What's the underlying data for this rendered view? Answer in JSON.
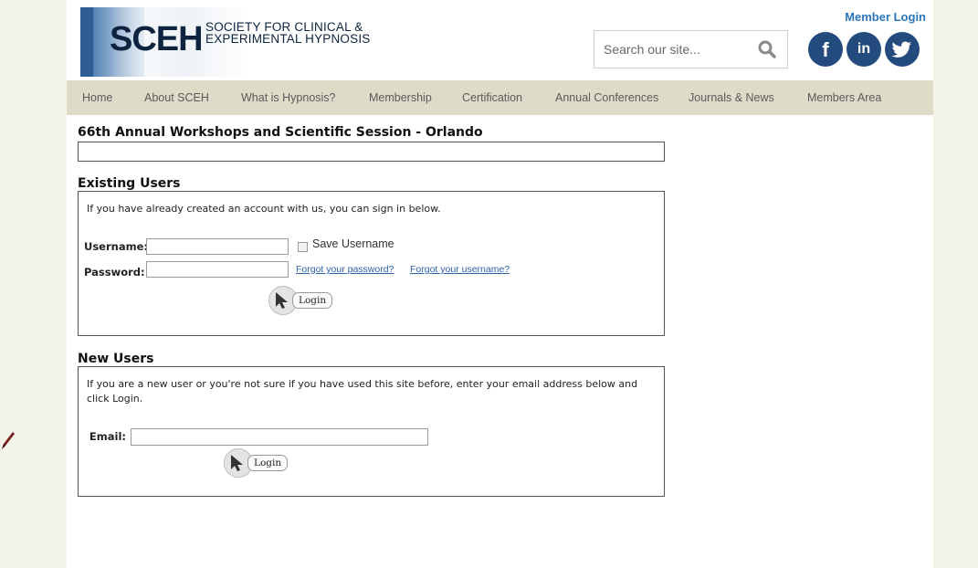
{
  "header": {
    "logo_text": "SCEH",
    "logo_sub_line1": "SOCIETY FOR CLINICAL &",
    "logo_sub_line2": "EXPERIMENTAL HYPNOSIS",
    "member_login": "Member Login",
    "search_placeholder": "Search our site...",
    "social": [
      {
        "name": "facebook",
        "glyph": "f"
      },
      {
        "name": "linkedin",
        "glyph": "in"
      },
      {
        "name": "twitter",
        "glyph": ""
      }
    ]
  },
  "nav": {
    "items": [
      "Home",
      "About SCEH",
      "What is Hypnosis?",
      "Membership",
      "Certification",
      "Annual Conferences",
      "Journals & News",
      "Members Area"
    ]
  },
  "page": {
    "title": "66th Annual Workshops and Scientific Session - Orlando"
  },
  "existing_users": {
    "heading": "Existing Users",
    "intro": "If you have already created an account with us, you can sign in below.",
    "username_label": "Username:",
    "username_value": "",
    "save_username_label": "Save Username",
    "password_label": "Password:",
    "password_value": "",
    "forgot_password": "Forgot your password?",
    "forgot_username": "Forgot your username?",
    "login_label": "Login"
  },
  "new_users": {
    "heading": "New Users",
    "intro": "If you are a new user or you're not sure if you have used this site before, enter your email address below and click Login.",
    "email_label": "Email:",
    "email_value": "",
    "login_label": "Login"
  },
  "colors": {
    "brand_navy": "#0d2340",
    "nav_bg": "#dedcc9",
    "link_blue": "#2b62a8",
    "social_blue": "#244b7e"
  }
}
